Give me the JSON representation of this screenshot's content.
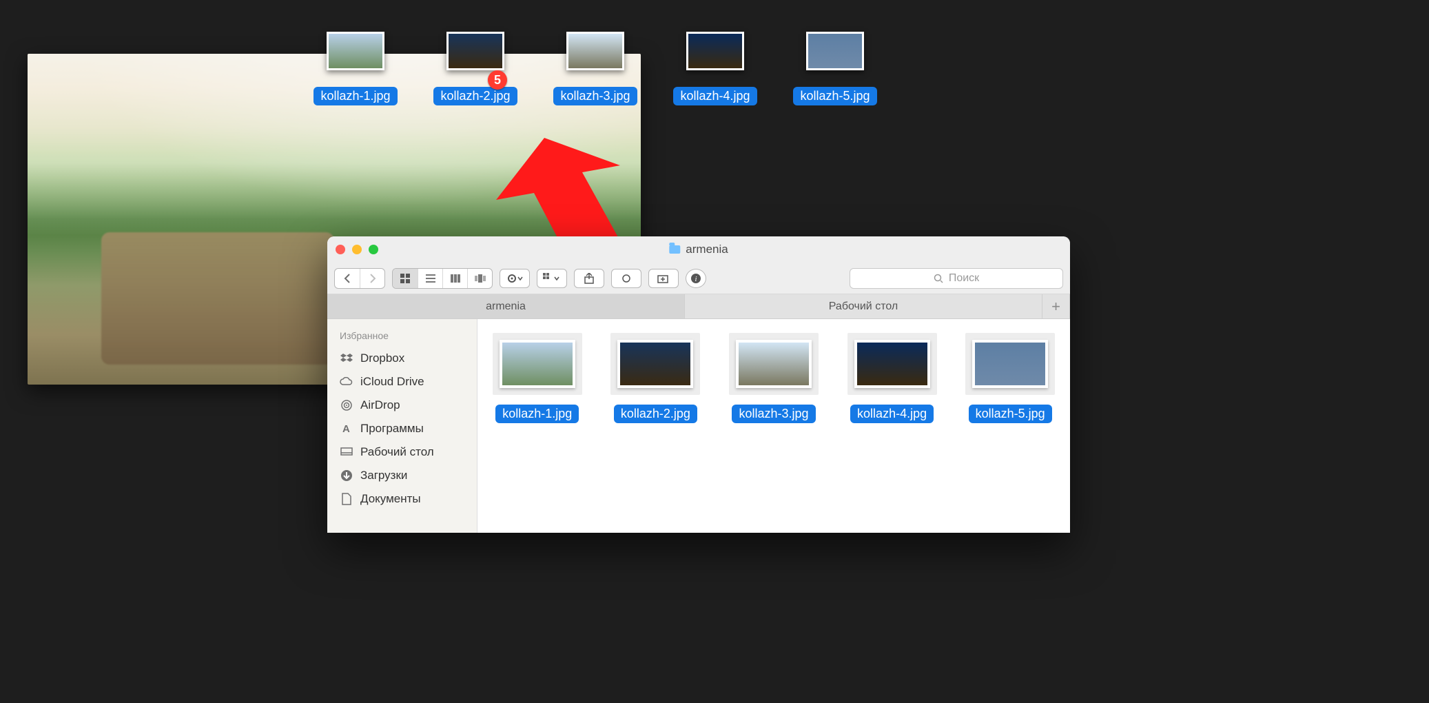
{
  "desktop": {
    "items": [
      {
        "name": "kollazh-1.jpg"
      },
      {
        "name": "kollazh-2.jpg"
      },
      {
        "name": "kollazh-3.jpg"
      },
      {
        "name": "kollazh-4.jpg"
      },
      {
        "name": "kollazh-5.jpg"
      }
    ],
    "badge_on_index": 1,
    "badge_value": "5"
  },
  "finder": {
    "window_title": "armenia",
    "search_placeholder": "Поиск",
    "tabs": [
      {
        "label": "armenia",
        "active": true
      },
      {
        "label": "Рабочий стол",
        "active": false
      }
    ],
    "add_tab_label": "+",
    "sidebar": {
      "header": "Избранное",
      "items": [
        {
          "label": "Dropbox"
        },
        {
          "label": "iCloud Drive"
        },
        {
          "label": "AirDrop"
        },
        {
          "label": "Программы"
        },
        {
          "label": "Рабочий стол"
        },
        {
          "label": "Загрузки"
        },
        {
          "label": "Документы"
        }
      ]
    },
    "files": [
      {
        "name": "kollazh-1.jpg"
      },
      {
        "name": "kollazh-2.jpg"
      },
      {
        "name": "kollazh-3.jpg"
      },
      {
        "name": "kollazh-4.jpg"
      },
      {
        "name": "kollazh-5.jpg"
      }
    ]
  }
}
